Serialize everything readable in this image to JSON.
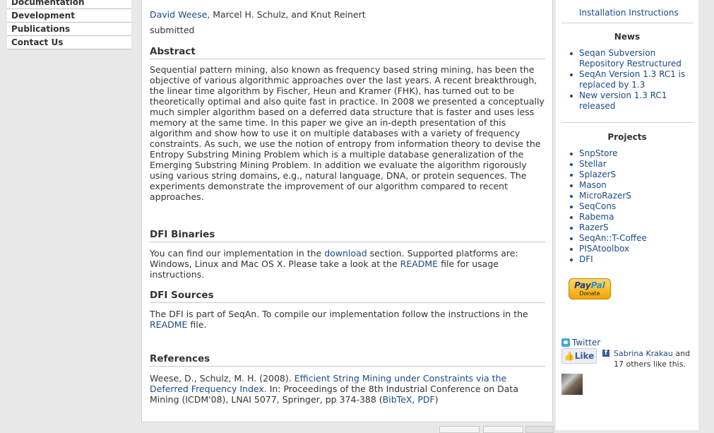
{
  "left_nav": {
    "items": [
      "Documentation",
      "Development",
      "Publications",
      "Contact Us"
    ]
  },
  "paper": {
    "authors_lead": "David Weese",
    "authors_rest": ", Marcel H. Schulz, and Knut Reinert",
    "status": "submitted",
    "abstract_heading": "Abstract",
    "abstract_text": "Sequential pattern mining, also known as frequency based string mining, has been the objective of various algorithmic approaches over the last years. A recent breakthrough, the linear time algorithm by Fischer, Heun and Kramer (FHK), has turned out to be theoretically optimal and also quite fast in practice. In 2008 we presented a conceptually much simpler algorithm based on a deferred data structure that is faster and uses less memory at the same time. In this paper we give an in-depth presentation of this algorithm and show how to use it on multiple databases with a variety of frequency constraints. As such, we use the notion of entropy from information theory to devise the Entropy Substring Mining Problem which is a multiple database generalization of the Emerging Substring Mining Problem. In addition we evaluate the algorithm rigorously using various string domains, e.g., natural language, DNA, or protein sequences. The experiments demonstrate the improvement of our algorithm compared to recent approaches.",
    "binaries_heading": "DFI Binaries",
    "binaries_text_1": "You can find our implementation in the ",
    "binaries_link_download": "download",
    "binaries_text_2": " section. Supported platforms are: Windows, Linux and Mac OS X. Please take a look at the ",
    "binaries_link_readme": "README",
    "binaries_text_3": " file for usage instructions.",
    "sources_heading": "DFI Sources",
    "sources_text_1": "The DFI is part of SeqAn. To compile our implementation follow the instructions in the ",
    "sources_link_readme": "README",
    "sources_text_2": " file.",
    "references_heading": "References",
    "ref_text_1": "Weese, D., Schulz, M. H. (2008). ",
    "ref_link_title": "Efficient String Mining under Constraints via the Deferred Frequency Index",
    "ref_text_2": ". In: Proceedings of the 8th Industrial Conference on Data Mining (ICDM'08), LNAI 5077, Springer, pp 374-388 (",
    "ref_link_bibtex": "BibTeX",
    "ref_text_3": ", ",
    "ref_link_pdf": "PDF",
    "ref_text_4": ")"
  },
  "sidebar": {
    "install_link": "Installation Instructions",
    "news_heading": "News",
    "news": [
      "Seqan Subversion Repository Restructured",
      "SeqAn Version 1.3 RC1 is replaced by 1.3",
      "New version 1.3 RC1 released"
    ],
    "projects_heading": "Projects",
    "projects": [
      "SnpStore",
      "Stellar",
      "SplazerS",
      "Mason",
      "MicroRazerS",
      "SeqCons",
      "Rabema",
      "RazerS",
      "SeqAn::T-Coffee",
      "PISAtoolbox",
      "DFI"
    ],
    "paypal_logo_a": "Pay",
    "paypal_logo_b": "Pal",
    "paypal_donate": "Donate",
    "twitter_label": "Twitter",
    "like_label": "Like",
    "fb_name": "Sabrina Krakau",
    "fb_rest": " and 17 others like this."
  },
  "icons": {
    "twitter": "twitter-icon",
    "facebook": "facebook-icon",
    "like": "thumbs-up-icon"
  },
  "colors": {
    "link": "#1c4a86",
    "paypal": "#f2a500",
    "facebook": "#3b5998",
    "twitter": "#4aa7d9"
  }
}
